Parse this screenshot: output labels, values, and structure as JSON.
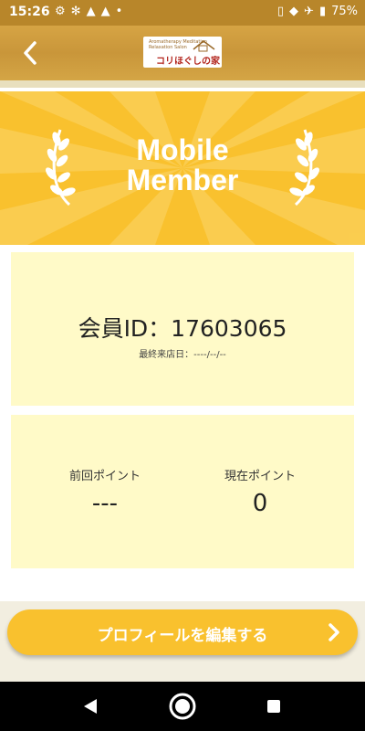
{
  "status_bar": {
    "time": "15:26",
    "battery": "75%",
    "left_icons": [
      "settings-icon",
      "fan-icon",
      "warning-icon",
      "warning-icon",
      "dot-icon"
    ],
    "right_icons": [
      "vibrate-icon",
      "wifi-icon",
      "airplane-icon",
      "battery-icon"
    ]
  },
  "header": {
    "back_icon": "chevron-left-icon",
    "logo_text_small": "Aromatherapy Meditation Relaxation Salon",
    "logo_text_main": "コリほぐしの家"
  },
  "banner": {
    "title_line1": "Mobile",
    "title_line2": "Member",
    "color": "#f9c12e"
  },
  "member": {
    "id_text": "会員ID：17603065",
    "last_visit": "最終来店日：----/--/--"
  },
  "points": {
    "previous_label": "前回ポイント",
    "previous_value": "---",
    "current_label": "現在ポイント",
    "current_value": "0"
  },
  "actions": {
    "edit_profile_label": "プロフィールを編集する",
    "edit_profile_icon": "chevron-right-icon"
  },
  "nav": {
    "icons": [
      "back-triangle-icon",
      "home-circle-icon",
      "recents-square-icon"
    ]
  },
  "colors": {
    "accent": "#f9c12e",
    "card": "#fffac8",
    "header": "#c9963a"
  }
}
